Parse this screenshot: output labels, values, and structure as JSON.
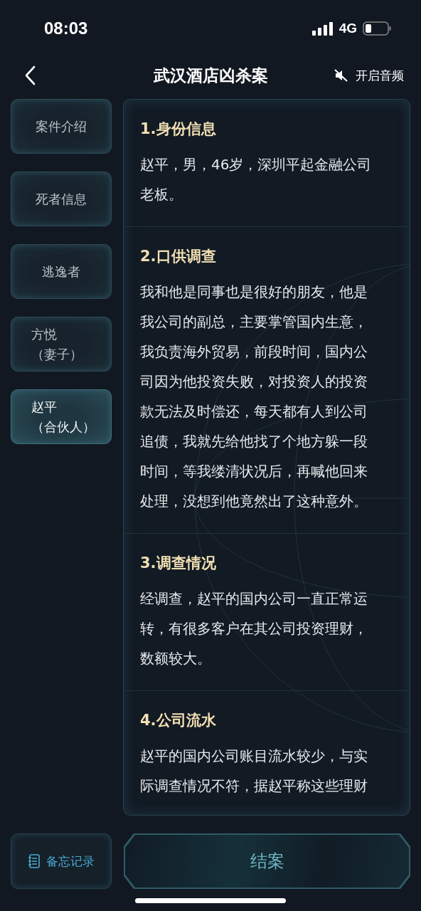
{
  "status_bar": {
    "time": "08:03",
    "network": "4G"
  },
  "nav": {
    "title": "武汉酒店凶杀案",
    "audio_label": "开启音频",
    "audio_muted": true
  },
  "sidebar": {
    "items": [
      {
        "label": "案件介绍",
        "selected": false
      },
      {
        "label": "死者信息",
        "selected": false
      },
      {
        "label": "逃逸者",
        "selected": false
      },
      {
        "label": "方悦",
        "note": "（妻子）",
        "selected": false
      },
      {
        "label": "赵平",
        "note": "（合伙人）",
        "selected": true
      }
    ]
  },
  "sections": [
    {
      "heading": "1.身份信息",
      "text": "赵平，男，46岁，深圳平起金融公司老板。"
    },
    {
      "heading": "2.口供调查",
      "text": "我和他是同事也是很好的朋友，他是我公司的副总，主要掌管国内生意，我负责海外贸易，前段时间，国内公司因为他投资失败，对投资人的投资款无法及时偿还，每天都有人到公司追债，我就先给他找了个地方躲一段时间，等我缕清状况后，再喊他回来处理，没想到他竟然出了这种意外。"
    },
    {
      "heading": "3.调查情况",
      "text": "经调查，赵平的国内公司一直正常运转，有很多客户在其公司投资理财，数额较大。"
    },
    {
      "heading": "4.公司流水",
      "text": "赵平的国内公司账目流水较少，与实际调查情况不符，据赵平称这些理财"
    }
  ],
  "footer": {
    "memo_label": "备忘记录",
    "close_case_label": "结案"
  }
}
